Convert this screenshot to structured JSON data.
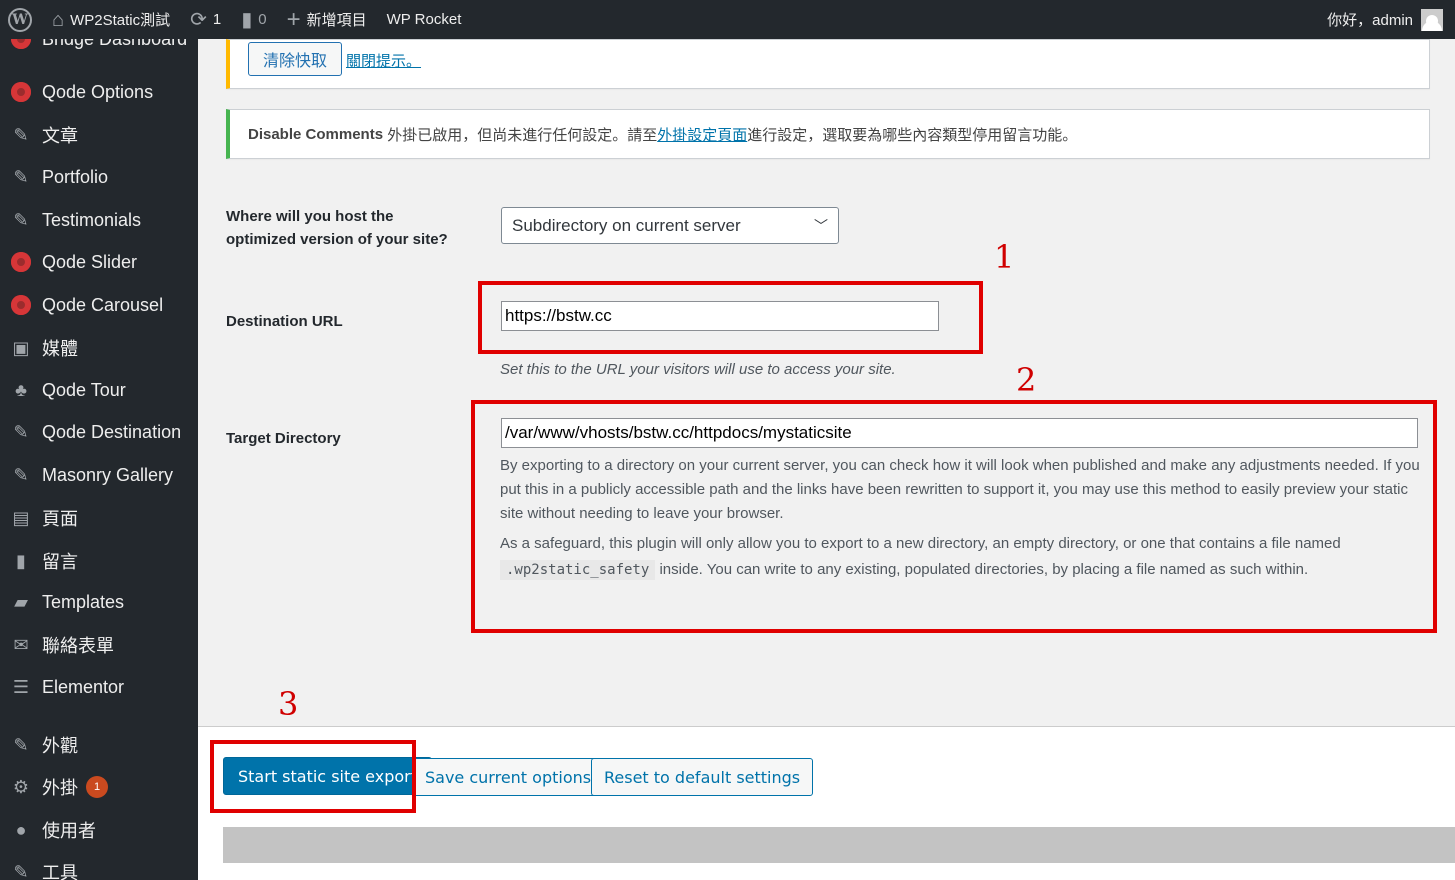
{
  "adminbar": {
    "site_name": "WP2Static測試",
    "updates_count": "1",
    "comments_count": "0",
    "new_label": "新增項目",
    "wp_rocket": "WP Rocket",
    "greeting": "你好，admin"
  },
  "sidebar": {
    "items": [
      {
        "label": "Bridge Dashboard",
        "icon": "dot-icon"
      },
      {
        "label": "Qode Options",
        "icon": "dot-icon"
      },
      {
        "label": "文章",
        "icon": "pin-icon"
      },
      {
        "label": "Portfolio",
        "icon": "pin-icon"
      },
      {
        "label": "Testimonials",
        "icon": "pin-icon"
      },
      {
        "label": "Qode Slider",
        "icon": "dot-icon"
      },
      {
        "label": "Qode Carousel",
        "icon": "dot-icon"
      },
      {
        "label": "媒體",
        "icon": "media-icon"
      },
      {
        "label": "Qode Tour",
        "icon": "palm-icon"
      },
      {
        "label": "Qode Destination",
        "icon": "pin-icon"
      },
      {
        "label": "Masonry Gallery",
        "icon": "pin-icon"
      },
      {
        "label": "頁面",
        "icon": "page-icon"
      },
      {
        "label": "留言",
        "icon": "comment-icon"
      },
      {
        "label": "Templates",
        "icon": "folder-icon"
      },
      {
        "label": "聯絡表單",
        "icon": "mail-icon"
      },
      {
        "label": "Elementor",
        "icon": "elementor-icon"
      },
      {
        "label": "外觀",
        "icon": "brush-icon"
      },
      {
        "label": "外掛",
        "icon": "plugin-icon",
        "badge": "1"
      },
      {
        "label": "使用者",
        "icon": "user-icon"
      },
      {
        "label": "工具",
        "icon": "wrench-icon"
      }
    ]
  },
  "notices": {
    "clear_cache_button": "清除快取",
    "dismiss_link": "關閉提示。",
    "comments_plugin": "Disable Comments",
    "comments_text_1": " 外掛已啟用，但尚未進行任何設定。請至",
    "comments_link": "外掛設定頁面",
    "comments_text_2": "進行設定，選取要為哪些內容類型停用留言功能。"
  },
  "form": {
    "host_label": "Where will you host the optimized version of your site?",
    "host_value": "Subdirectory on current server",
    "dest_label": "Destination URL",
    "dest_value": "https://bstw.cc",
    "dest_desc": "Set this to the URL your visitors will use to access your site.",
    "target_label": "Target Directory",
    "target_value": "/var/www/vhosts/bstw.cc/httpdocs/mystaticsite",
    "target_desc_1": "By exporting to a directory on your current server, you can check how it will look when published and make any adjustments needed. If you put this in a publicly accessible path and the links have been rewritten to support it, you may use this method to easily preview your static site without needing to leave your browser.",
    "target_desc_2a": "As a safeguard, this plugin will only allow you to export to a new directory, an empty directory, or one that contains a file named",
    "target_desc_code": ".wp2static_safety",
    "target_desc_2b": "inside. You can write to any existing, populated directories, by placing a file named as such within."
  },
  "annotations": {
    "one": "1",
    "two": "2",
    "three": "3"
  },
  "footer": {
    "start_button": "Start static site export",
    "save_button": "Save current options",
    "reset_button": "Reset to default settings"
  },
  "colors": {
    "accent": "#0073aa",
    "annotation_red": "#e00000",
    "sidebar_bg": "#23282d"
  }
}
